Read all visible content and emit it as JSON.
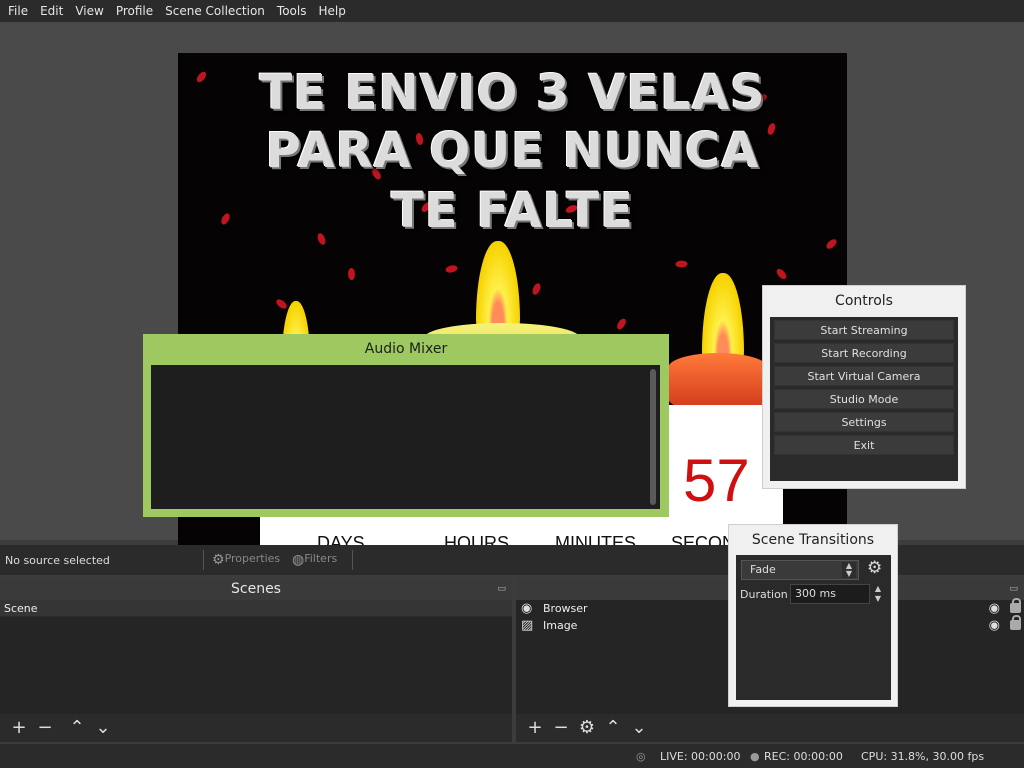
{
  "menu": [
    "File",
    "Edit",
    "View",
    "Profile",
    "Scene Collection",
    "Tools",
    "Help"
  ],
  "preview": {
    "headline": [
      "TE ENVIO 3 VELAS",
      "PARA QUE NUNCA",
      "TE FALTE"
    ],
    "countdown_value": "57",
    "countdown_labels": [
      "DAYS",
      "HOURS",
      "MINUTES",
      "SECONDS"
    ]
  },
  "audio_mixer": {
    "title": "Audio Mixer"
  },
  "controls": {
    "title": "Controls",
    "buttons": [
      "Start Streaming",
      "Start Recording",
      "Start Virtual Camera",
      "Studio Mode",
      "Settings",
      "Exit"
    ]
  },
  "transitions": {
    "title": "Scene Transitions",
    "selected": "Fade",
    "duration_label": "Duration",
    "duration_value": "300 ms"
  },
  "source_toolbar": {
    "no_source": "No source selected",
    "properties": "Properties",
    "filters": "Filters"
  },
  "scenes": {
    "title": "Scenes",
    "items": [
      "Scene"
    ]
  },
  "sources": {
    "items": [
      {
        "name": "Browser",
        "icon": "globe-icon"
      },
      {
        "name": "Image",
        "icon": "image-icon"
      }
    ]
  },
  "status": {
    "live": "LIVE: 00:00:00",
    "rec": "REC: 00:00:00",
    "cpu": "CPU: 31.8%, 30.00 fps"
  },
  "colors": {
    "audio_mixer_border": "#9dc960",
    "countdown_red": "#d01010",
    "background": "#3c3c3c"
  }
}
